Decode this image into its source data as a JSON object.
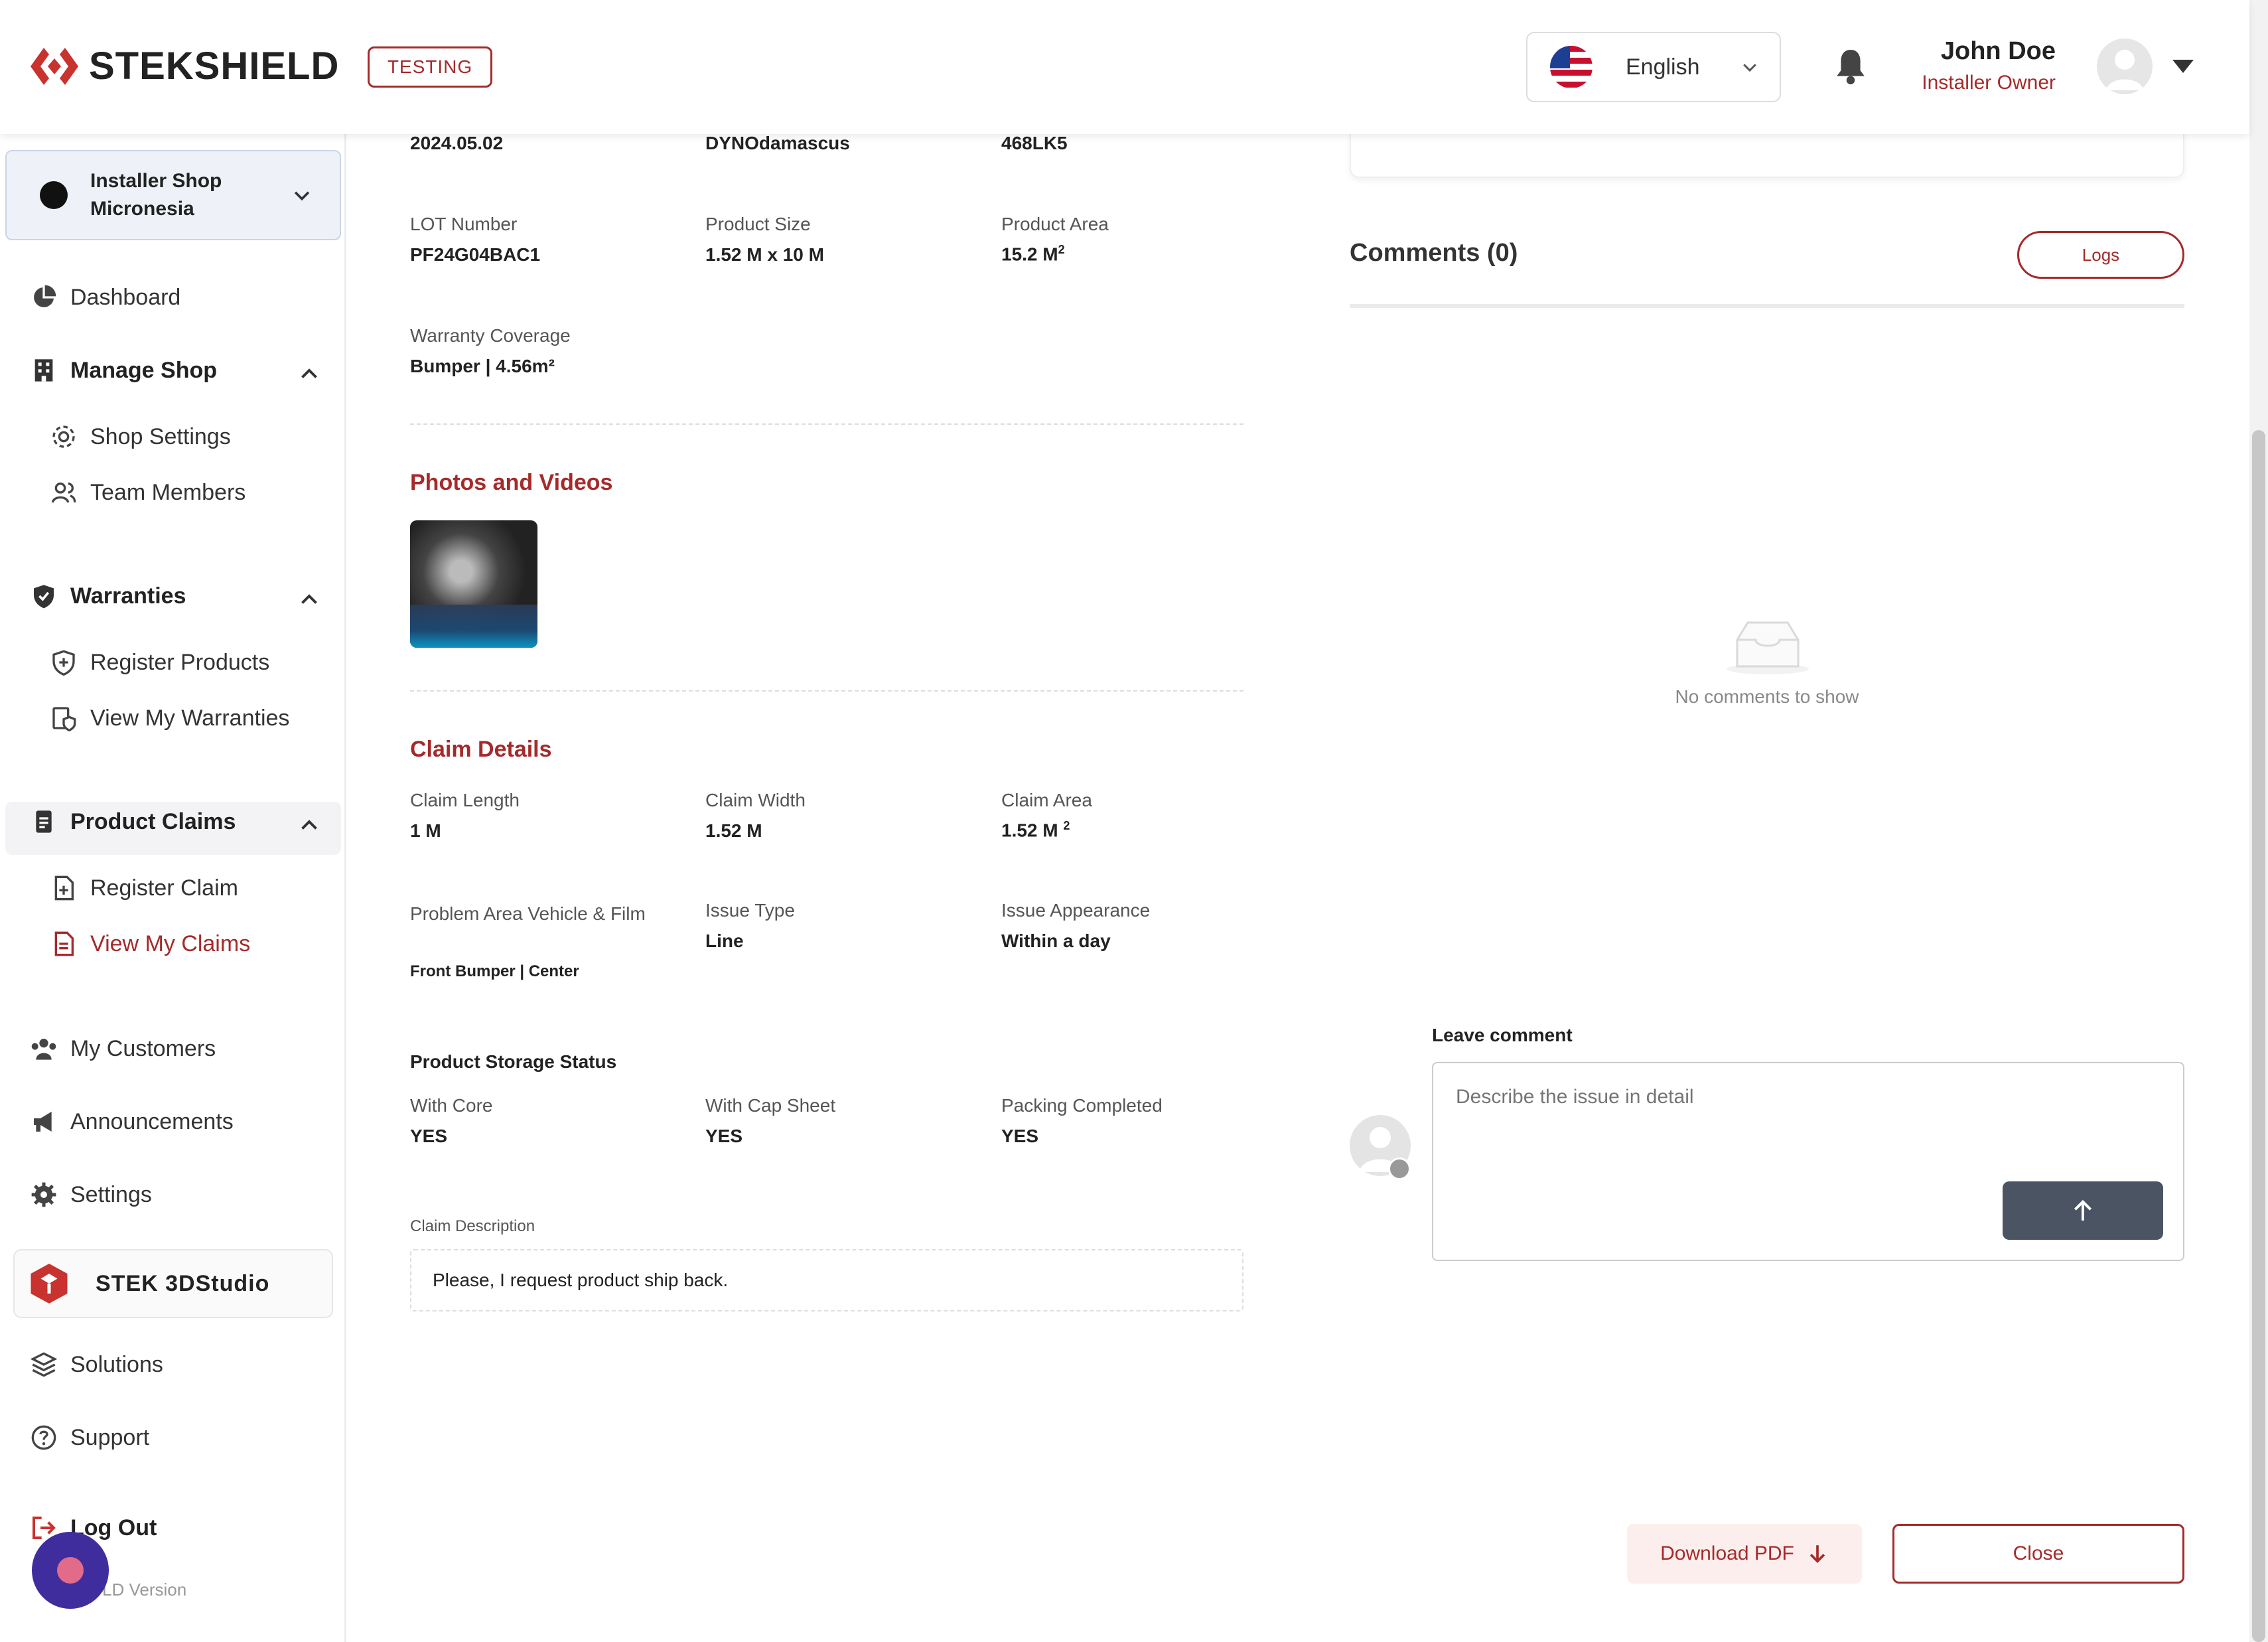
{
  "header": {
    "brand": "STEKSHIELD",
    "env_badge": "TESTING",
    "language": "English",
    "user_name": "John Doe",
    "user_role": "Installer Owner"
  },
  "sidebar": {
    "shop_name": "Installer Shop Micronesia",
    "dashboard": "Dashboard",
    "manage_shop": "Manage Shop",
    "shop_settings": "Shop Settings",
    "team_members": "Team Members",
    "warranties": "Warranties",
    "register_products": "Register Products",
    "view_warranties": "View My Warranties",
    "product_claims": "Product Claims",
    "register_claim": "Register Claim",
    "view_claims": "View My Claims",
    "my_customers": "My Customers",
    "announcements": "Announcements",
    "settings": "Settings",
    "stek3d": "STEK 3DStudio",
    "solutions": "Solutions",
    "support": "Support",
    "logout": "Log Out",
    "version": "LD Version"
  },
  "product": {
    "top_values": [
      "2024.05.02",
      "DYNOdamascus",
      "468LK5"
    ],
    "lot_number_label": "LOT Number",
    "lot_number": "PF24G04BAC1",
    "product_size_label": "Product Size",
    "product_size": "1.52 M x 10 M",
    "product_area_label": "Product Area",
    "product_area": "15.2 M",
    "product_area_sup": "2",
    "warranty_coverage_label": "Warranty Coverage",
    "warranty_coverage": "Bumper | 4.56m²"
  },
  "photos": {
    "title": "Photos and Videos"
  },
  "claim": {
    "title": "Claim Details",
    "length_label": "Claim Length",
    "length": "1 M",
    "width_label": "Claim Width",
    "width": "1.52 M",
    "area_label": "Claim Area",
    "area": "1.52 M",
    "area_sup": "2",
    "problem_label": "Problem Area Vehicle & Film",
    "problem": "Front Bumper | Center",
    "issue_type_label": "Issue Type",
    "issue_type": "Line",
    "appearance_label": "Issue Appearance",
    "appearance": "Within a day",
    "storage_title": "Product Storage Status",
    "with_core_label": "With Core",
    "with_core": "YES",
    "cap_sheet_label": "With Cap Sheet",
    "cap_sheet": "YES",
    "packing_label": "Packing Completed",
    "packing": "YES",
    "description_label": "Claim Description",
    "description": "Please, I request product ship back."
  },
  "comments": {
    "title": "Comments (0)",
    "logs_label": "Logs",
    "empty_text": "No comments to show",
    "leave_label": "Leave comment",
    "placeholder": "Describe the issue in detail"
  },
  "actions": {
    "download_pdf": "Download PDF",
    "close": "Close"
  },
  "colors": {
    "accent": "#a52a2a",
    "send_button": "#4a5462",
    "chat_bubble": "#3f2d9e"
  }
}
